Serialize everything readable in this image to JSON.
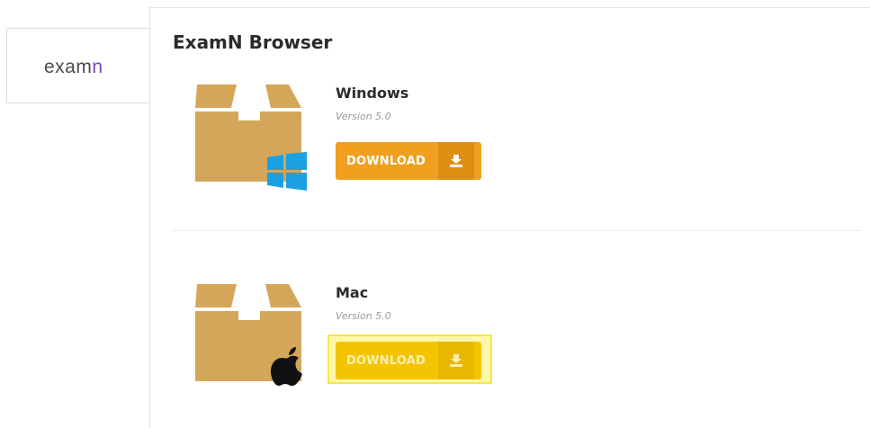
{
  "sidebar": {
    "tab_prefix": "exam",
    "tab_accent": "n"
  },
  "main": {
    "title": "ExamN Browser",
    "downloads": [
      {
        "os": "Windows",
        "version": "Version 5.0",
        "button_label": "DOWNLOAD",
        "icon": "windows-logo-icon",
        "button_color": "#f0a01e"
      },
      {
        "os": "Mac",
        "version": "Version 5.0",
        "button_label": "DOWNLOAD",
        "icon": "apple-logo-icon",
        "button_color": "#f5c400"
      }
    ]
  },
  "colors": {
    "package_box": "#d4a65a",
    "windows_blue": "#1ba1e2",
    "tab_accent": "#7b3fc4",
    "highlight": "#fff7a8"
  }
}
